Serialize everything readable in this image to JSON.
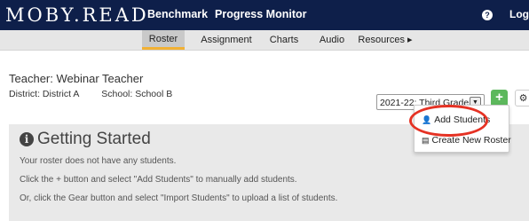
{
  "app": {
    "logo": "MOBY.READ"
  },
  "topnav": {
    "benchmark": "Benchmark",
    "progress_monitor": "Progress Monitor",
    "help_icon": "question-circle-icon",
    "help_glyph": "?",
    "login": "Log"
  },
  "subnav": {
    "items": [
      {
        "label": "Roster",
        "active": true
      },
      {
        "label": "Assignment"
      },
      {
        "label": "Charts"
      },
      {
        "label": "Audio"
      },
      {
        "label": "Resources ▸"
      }
    ]
  },
  "teacher": {
    "line": "Teacher: Webinar Teacher",
    "district": "District: District A",
    "school": "School: School B"
  },
  "controls": {
    "year_value": "2021-22: Third Grade",
    "year_chevron": "▼",
    "add_glyph": "+",
    "gear_glyph": "⚙"
  },
  "dropdown": {
    "add_students": "Add Students",
    "create_roster": "Create New Roster",
    "add_icon": "add-user-icon",
    "roster_icon": "roster-icon"
  },
  "getting_started": {
    "title": "Getting Started",
    "info_glyph": "i",
    "lines": [
      "Your roster does not have any students.",
      "Click the + button and select \"Add Students\" to manually add students.",
      "Or, click the Gear button and select \"Import Students\" to upload a list of students."
    ]
  },
  "colors": {
    "topbar": "#0e1f4a",
    "subnav": "#e6e6e6",
    "add_button": "#5cb85c",
    "highlight": "#e53224",
    "active_tab_underline": "#f2b134"
  }
}
